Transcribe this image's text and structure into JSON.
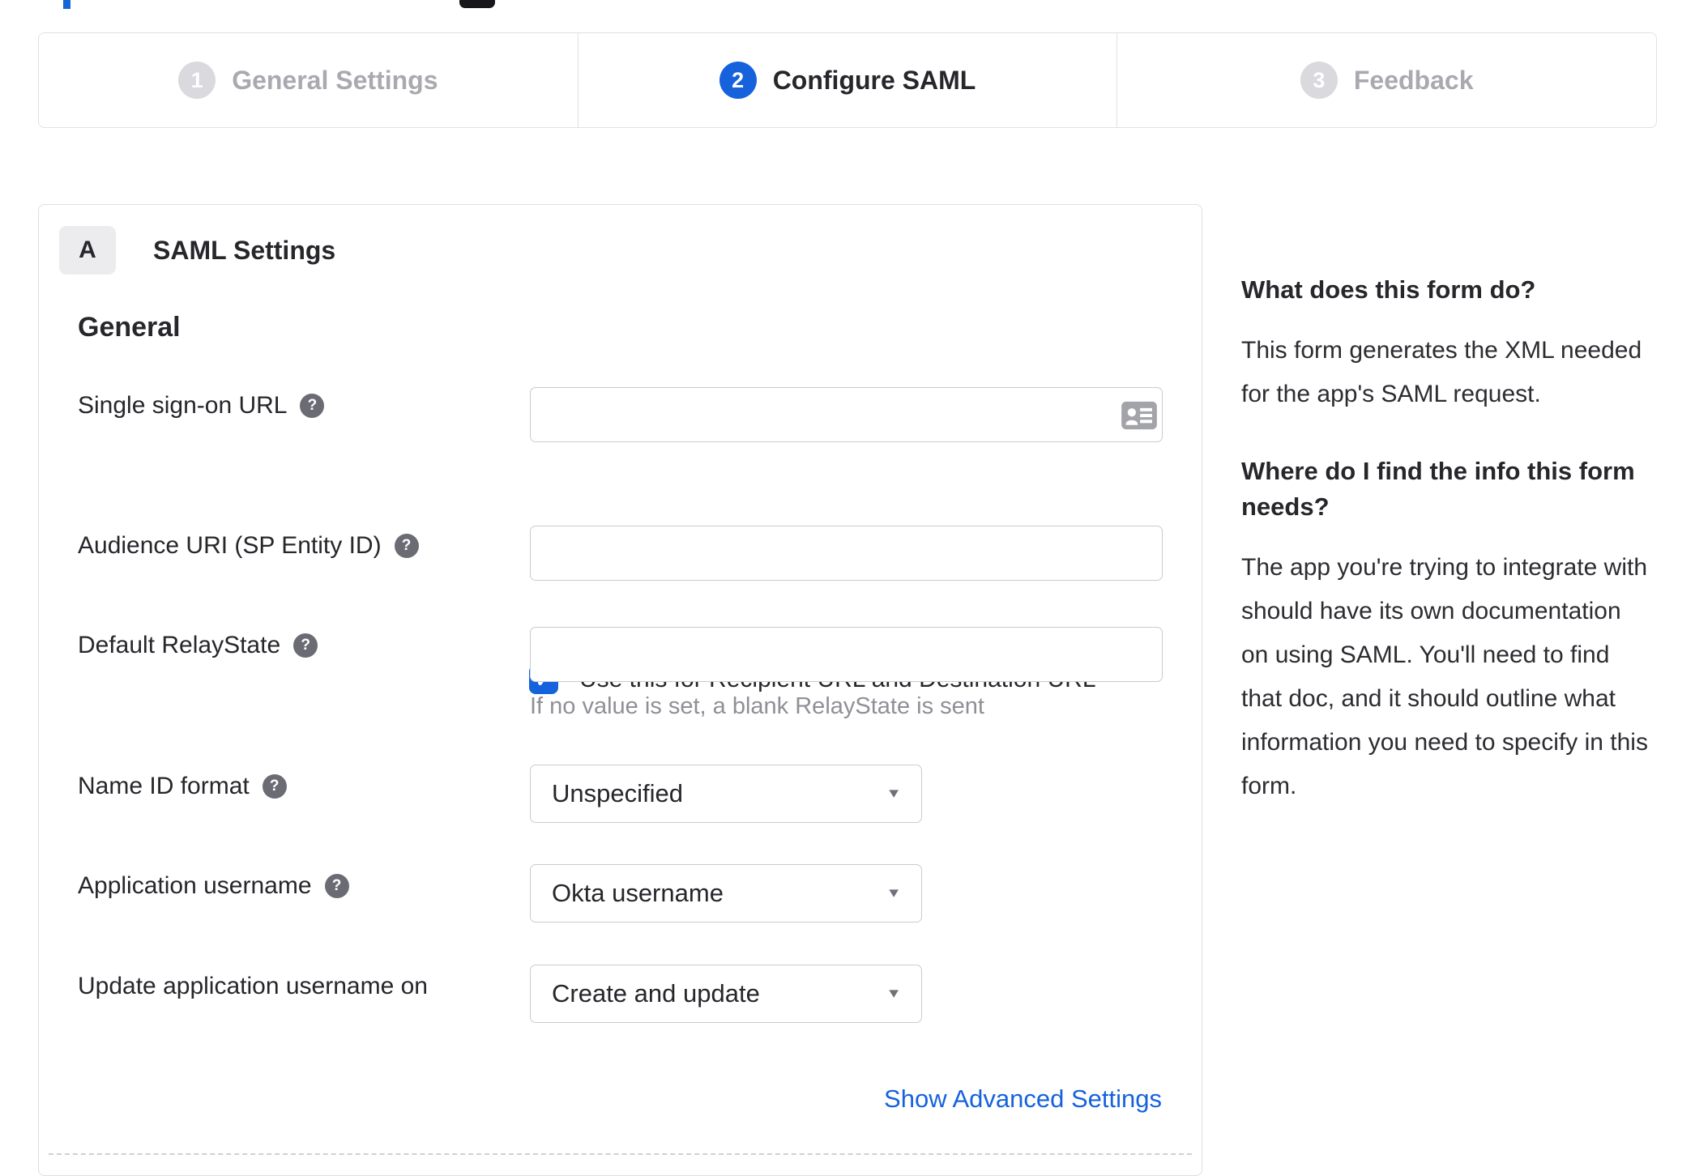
{
  "stepper": {
    "steps": [
      {
        "number": "1",
        "label": "General Settings",
        "state": "inactive"
      },
      {
        "number": "2",
        "label": "Configure SAML",
        "state": "active"
      },
      {
        "number": "3",
        "label": "Feedback",
        "state": "inactive"
      }
    ]
  },
  "panel": {
    "section_letter": "A",
    "section_title": "SAML Settings",
    "group_title": "General"
  },
  "form": {
    "sso": {
      "label": "Single sign-on URL",
      "value": "",
      "checkbox_label": "Use this for Recipient URL and Destination URL",
      "checkbox_checked": true
    },
    "audience": {
      "label": "Audience URI (SP Entity ID)",
      "value": ""
    },
    "relay": {
      "label": "Default RelayState",
      "value": "",
      "hint": "If no value is set, a blank RelayState is sent"
    },
    "name_id": {
      "label": "Name ID format",
      "value": "Unspecified"
    },
    "app_username": {
      "label": "Application username",
      "value": "Okta username"
    },
    "update_username": {
      "label": "Update application username on",
      "value": "Create and update"
    },
    "advanced_link_label": "Show Advanced Settings"
  },
  "help": {
    "s1": {
      "heading": "What does this form do?",
      "body": "This form generates the XML needed for the app's SAML request."
    },
    "s2": {
      "heading": "Where do I find the info this form needs?",
      "body": "The app you're trying to integrate with should have its own documentation on using SAML. You'll need to find that doc, and it should outline what information you need to specify in this form."
    }
  },
  "icons": {
    "help_glyph": "?",
    "check_glyph": "✓",
    "caret_glyph": "▼"
  },
  "colors": {
    "accent_blue": "#1662dd",
    "inactive_gray": "#a9a9b0",
    "text_dark": "#26262b",
    "hint_gray": "#8f8f97"
  }
}
